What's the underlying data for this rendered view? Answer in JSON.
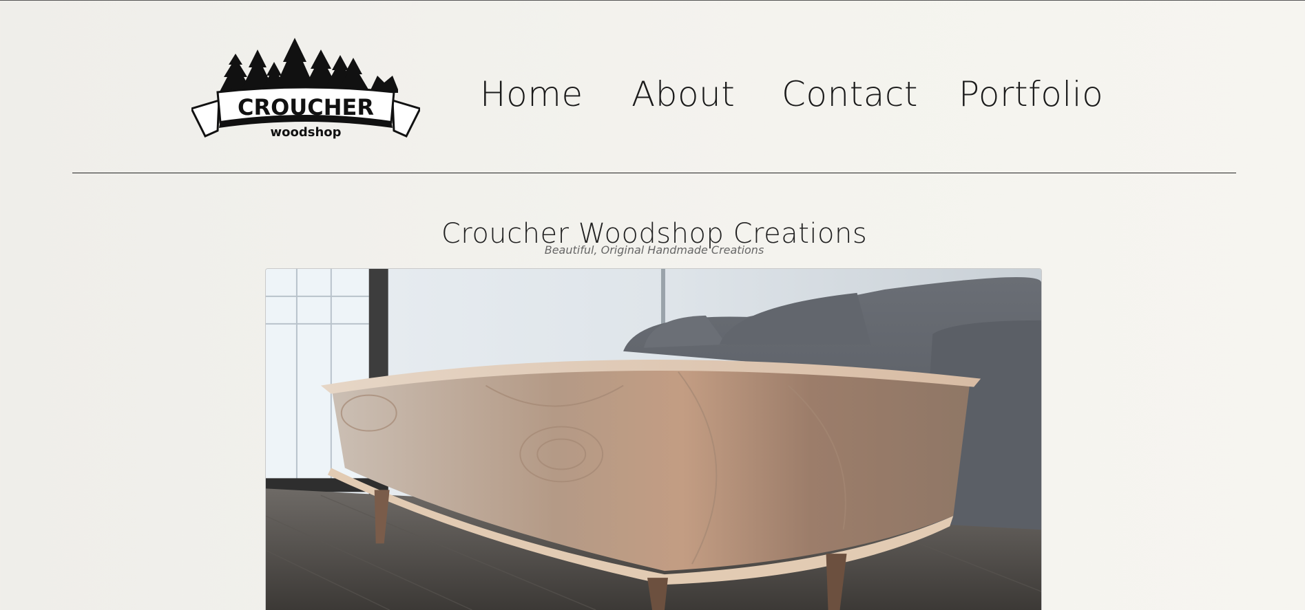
{
  "brand": {
    "logo_name": "CROUCHER",
    "logo_sub": "woodshop"
  },
  "nav": {
    "items": [
      "Home",
      "About",
      "Contact",
      "Portfolio"
    ]
  },
  "hero": {
    "title": "Croucher Woodshop Creations",
    "tagline": "Beautiful, Original Handmade Creations"
  },
  "icons": {
    "logo": "tree-banner-logo",
    "image": "coffee-table-photo"
  }
}
